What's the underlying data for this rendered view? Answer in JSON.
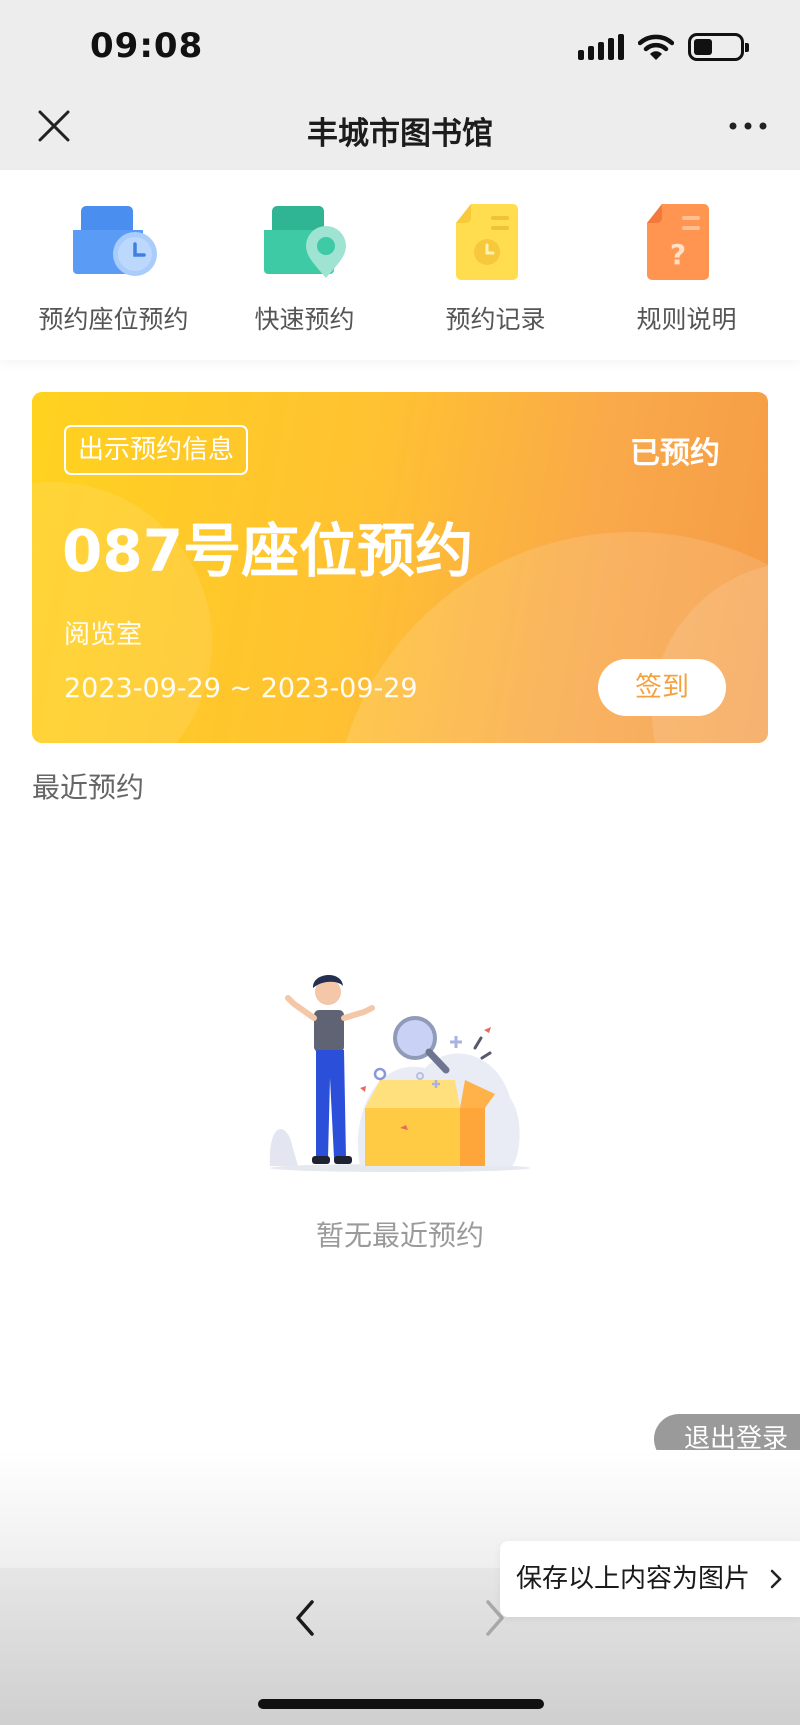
{
  "status_bar": {
    "time": "09:08"
  },
  "nav": {
    "title": "丰城市图书馆"
  },
  "menu": {
    "items": [
      {
        "label": "预约座位预约",
        "icon": "seat-clock-icon",
        "color": "#4a90f2"
      },
      {
        "label": "快速预约",
        "icon": "seat-location-icon",
        "color": "#3cc7a4"
      },
      {
        "label": "预约记录",
        "icon": "record-document-icon",
        "color": "#ffd64a"
      },
      {
        "label": "规则说明",
        "icon": "rules-question-icon",
        "color": "#ff8f4a"
      }
    ]
  },
  "reservation": {
    "show_info_label": "出示预约信息",
    "status": "已预约",
    "title": "087号座位预约",
    "room": "阅览室",
    "date_range": "2023-09-29 ~ 2023-09-29",
    "checkin_label": "签到"
  },
  "recent": {
    "title": "最近预约",
    "empty_text": "暂无最近预约"
  },
  "logout_label": "退出登录",
  "save_image_label": "保存以上内容为图片"
}
